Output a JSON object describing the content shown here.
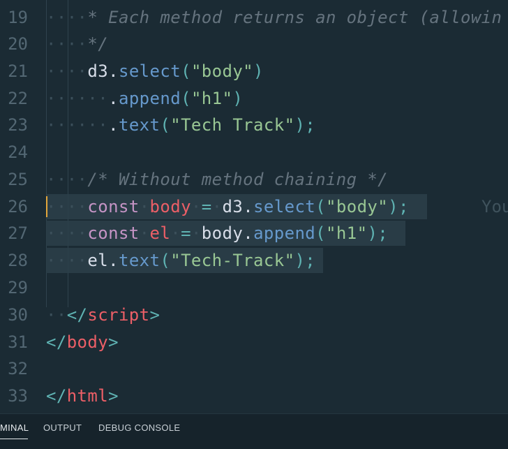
{
  "editor": {
    "line_numbers": [
      "19",
      "20",
      "21",
      "22",
      "23",
      "24",
      "25",
      "26",
      "27",
      "28",
      "29",
      "30",
      "31",
      "32",
      "33"
    ],
    "lines": [
      {
        "text": "* Each method returns an object (allowin"
      },
      {
        "text": "*/"
      },
      {
        "parts": [
          "d3",
          ".",
          "select",
          "(",
          "\"body\"",
          ")"
        ]
      },
      {
        "parts": [
          ".",
          "append",
          "(",
          "\"h1\"",
          ")"
        ]
      },
      {
        "parts": [
          ".",
          "text",
          "(",
          "\"Tech Track\"",
          ");"
        ]
      },
      {
        "text": ""
      },
      {
        "text": "/* Without method chaining */"
      },
      {
        "parts": [
          "const",
          "body",
          "=",
          "d3",
          ".",
          "select",
          "(",
          "\"body\"",
          ");"
        ]
      },
      {
        "parts": [
          "const",
          "el",
          "=",
          "body",
          ".",
          "append",
          "(",
          "\"h1\"",
          ");"
        ]
      },
      {
        "parts": [
          "el",
          ".",
          "text",
          "(",
          "\"Tech-Track\"",
          ");"
        ]
      },
      {
        "text": ""
      },
      {
        "parts": [
          "</",
          "script",
          ">"
        ]
      },
      {
        "parts": [
          "</",
          "body",
          ">"
        ]
      },
      {
        "text": ""
      },
      {
        "parts": [
          "</",
          "html",
          ">"
        ]
      }
    ],
    "ghost_text": "You"
  },
  "panel": {
    "tabs": [
      "MINAL",
      "OUTPUT",
      "DEBUG CONSOLE"
    ]
  },
  "colors": {
    "background": "#1b2b34",
    "comment": "#65737e",
    "function": "#6699cc",
    "string": "#99c794",
    "keyword": "#c594c5",
    "tag": "#ec5f67",
    "cursor": "#e3a63b"
  }
}
